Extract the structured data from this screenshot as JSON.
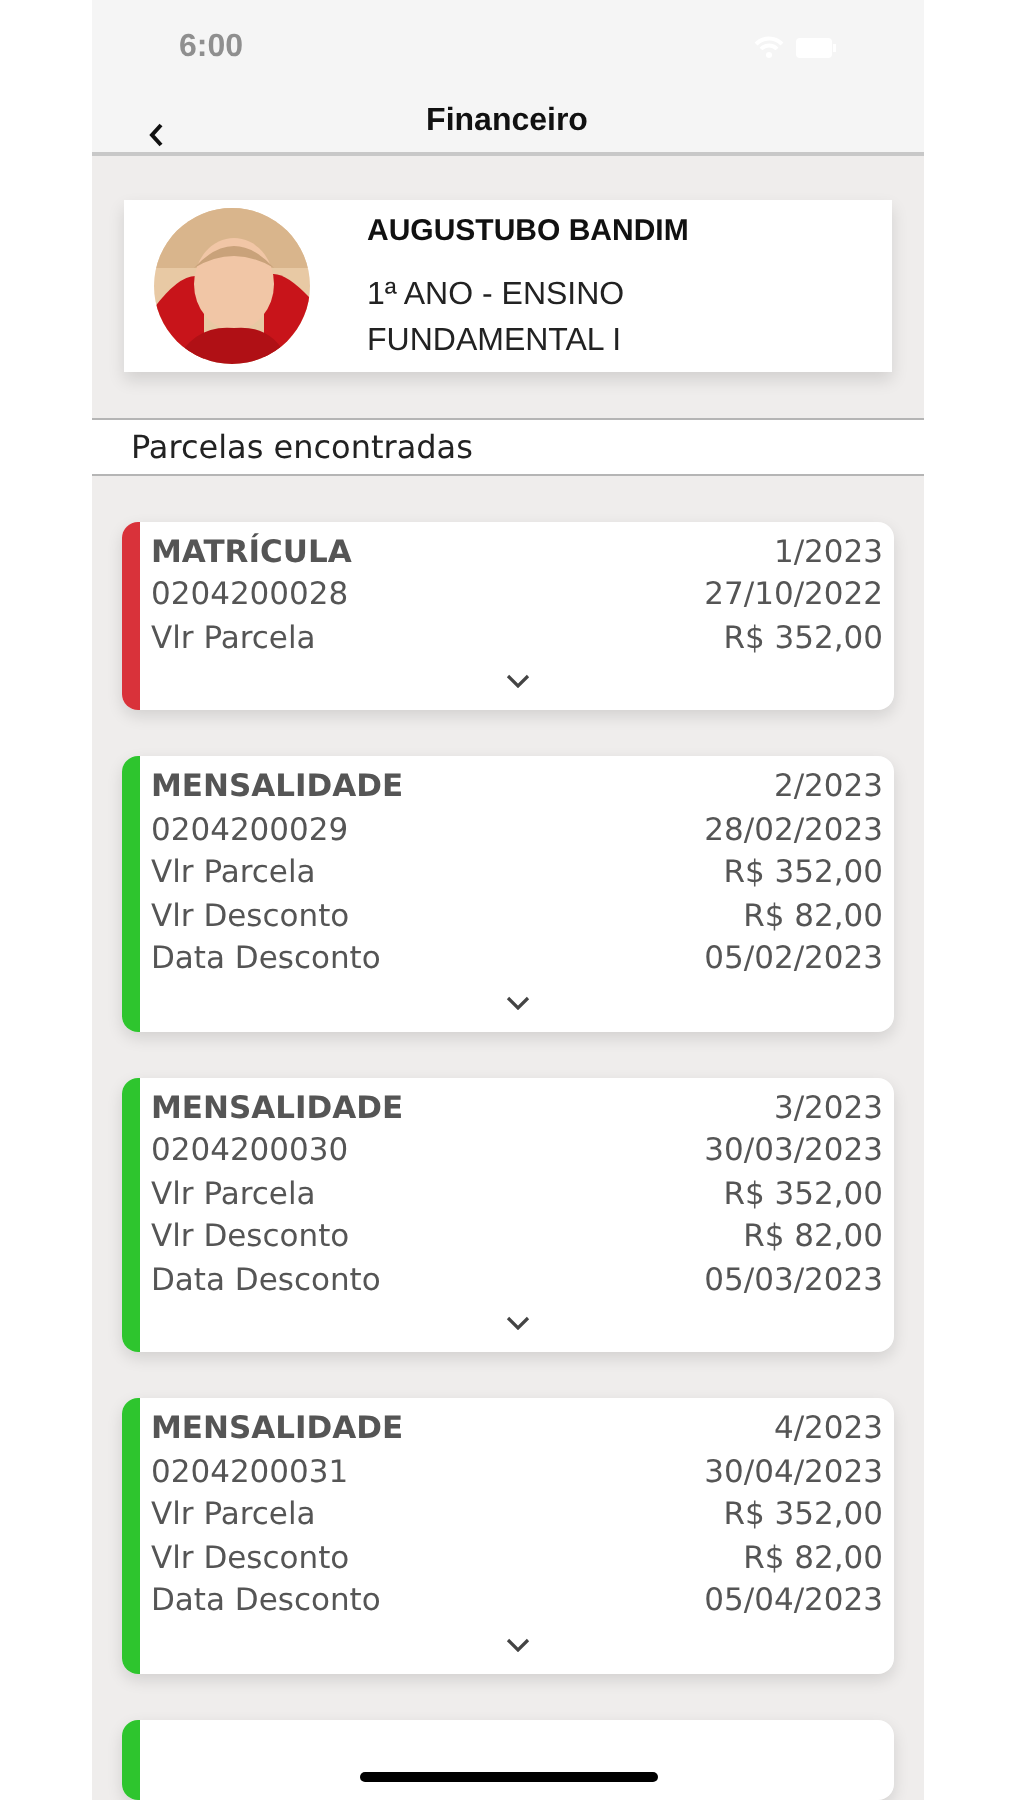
{
  "status_bar": {
    "time": "6:00"
  },
  "header": {
    "title": "Financeiro"
  },
  "student": {
    "name": "AUGUSTUBO BANDIM",
    "class": "1ª ANO - ENSINO FUNDAMENTAL I"
  },
  "section_title": "Parcelas encontradas",
  "installments": [
    {
      "type": "MATRÍCULA",
      "period": "1/2023",
      "code": "0204200028",
      "due_date": "27/10/2022",
      "color": "#d9323a",
      "fields": [
        {
          "label": "Vlr Parcela",
          "value": "R$ 352,00"
        }
      ]
    },
    {
      "type": "MENSALIDADE",
      "period": "2/2023",
      "code": "0204200029",
      "due_date": "28/02/2023",
      "color": "#2ec52e",
      "fields": [
        {
          "label": "Vlr Parcela",
          "value": "R$ 352,00"
        },
        {
          "label": "Vlr Desconto",
          "value": "R$ 82,00"
        },
        {
          "label": "Data Desconto",
          "value": "05/02/2023"
        }
      ]
    },
    {
      "type": "MENSALIDADE",
      "period": "3/2023",
      "code": "0204200030",
      "due_date": "30/03/2023",
      "color": "#2ec52e",
      "fields": [
        {
          "label": "Vlr Parcela",
          "value": "R$ 352,00"
        },
        {
          "label": "Vlr Desconto",
          "value": "R$ 82,00"
        },
        {
          "label": "Data Desconto",
          "value": "05/03/2023"
        }
      ]
    },
    {
      "type": "MENSALIDADE",
      "period": "4/2023",
      "code": "0204200031",
      "due_date": "30/04/2023",
      "color": "#2ec52e",
      "fields": [
        {
          "label": "Vlr Parcela",
          "value": "R$ 352,00"
        },
        {
          "label": "Vlr Desconto",
          "value": "R$ 82,00"
        },
        {
          "label": "Data Desconto",
          "value": "05/04/2023"
        }
      ]
    },
    {
      "color": "#2ec52e"
    }
  ]
}
